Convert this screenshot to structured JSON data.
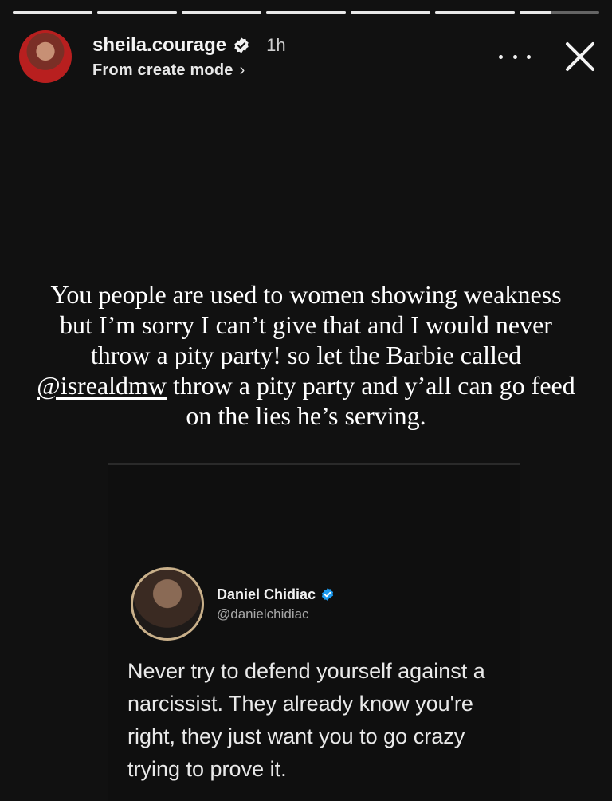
{
  "progress": [
    1,
    1,
    1,
    1,
    1,
    1,
    0.4
  ],
  "header": {
    "username": "sheila.courage",
    "time": "1h",
    "subtitle": "From create mode",
    "chevron": "›"
  },
  "caption": {
    "before_mention": "You people are used to women showing weakness but I’m sorry I can’t give that and I would never throw a pity party! so let the Barbie called ",
    "mention": "@isrealdmw",
    "after_mention": " throw a pity party and y’all can go feed on the lies he’s serving."
  },
  "tweet": {
    "name": "Daniel Chidiac",
    "handle": "@danielchidiac",
    "text": "Never try to defend yourself against a narcissist. They already know you're right, they just want you to go crazy trying to prove it."
  },
  "icons": {
    "verified": "verified-badge-icon",
    "more": "more-options-icon",
    "close": "close-icon"
  },
  "colors": {
    "background": "#111111",
    "tweet_verified": "#1d9bf0"
  }
}
